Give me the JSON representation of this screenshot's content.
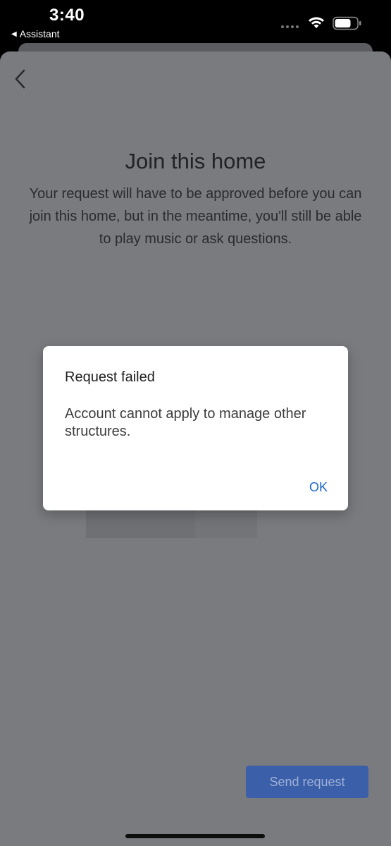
{
  "status_bar": {
    "time": "3:40",
    "back_app_label": "Assistant",
    "icons": [
      "wifi-icon",
      "battery-icon"
    ]
  },
  "page": {
    "title": "Join this home",
    "description": "Your request will have to be approved before you can join this home, but in the meantime, you'll still be able to play music or ask questions.",
    "send_button_label": "Send request"
  },
  "dialog": {
    "title": "Request failed",
    "message": "Account cannot apply to manage other structures.",
    "ok_label": "OK"
  },
  "colors": {
    "dim_background": "#7a7b7e",
    "accent_blue": "#1a66c9",
    "send_button": "#3b5fa8"
  }
}
